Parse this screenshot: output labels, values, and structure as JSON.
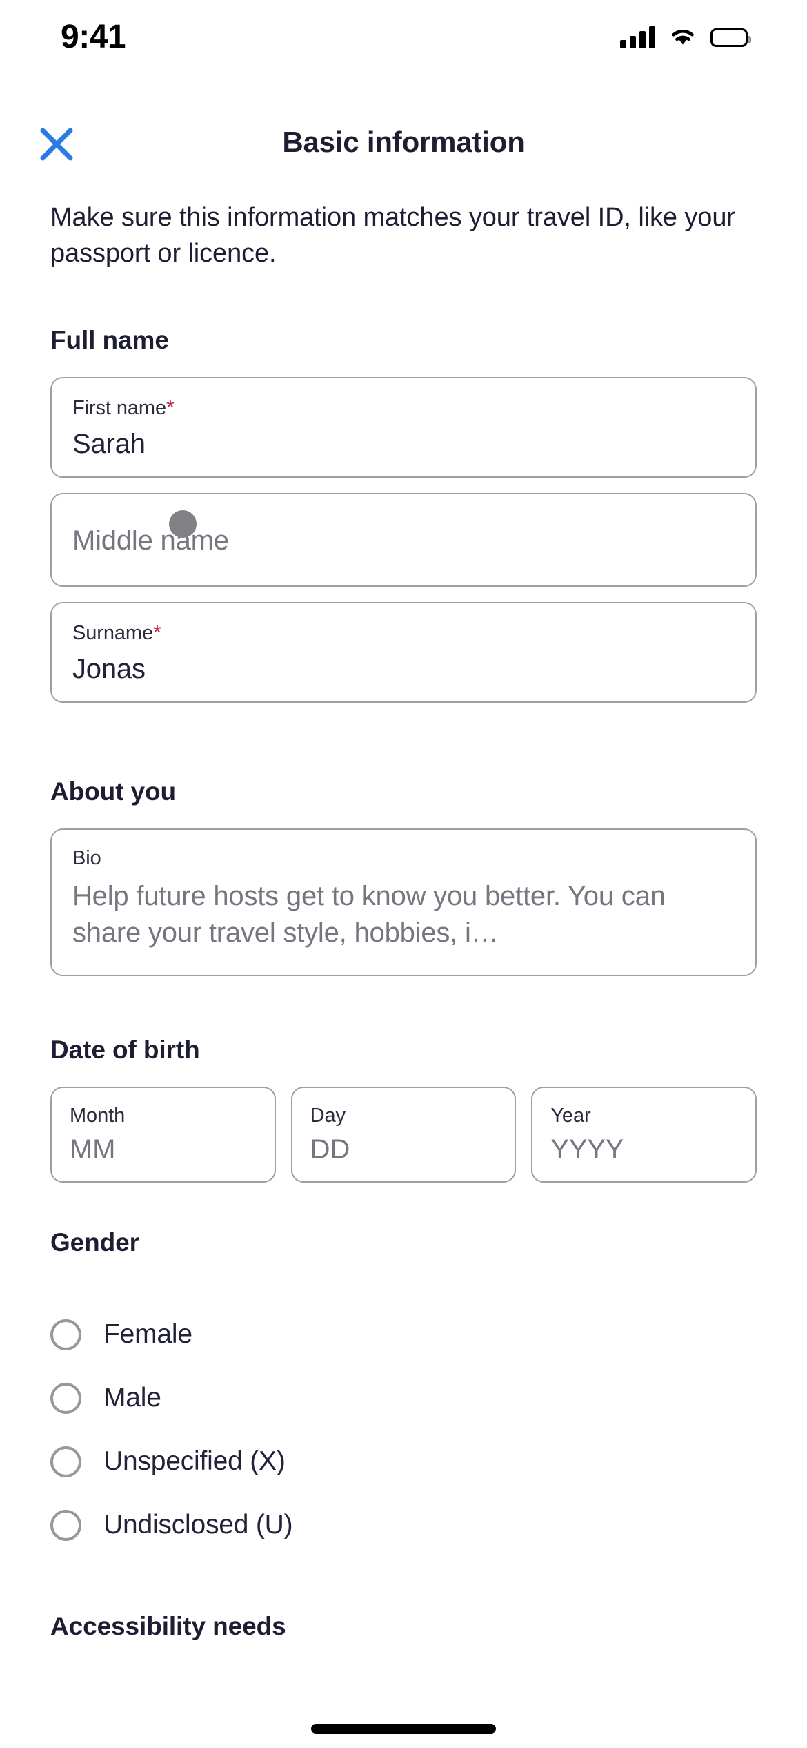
{
  "status_bar": {
    "time": "9:41",
    "signal_icon": "cellular-signal-icon",
    "wifi_icon": "wifi-icon",
    "battery_icon": "battery-icon"
  },
  "header": {
    "close_icon": "close-icon",
    "title": "Basic information"
  },
  "intro": {
    "text": "Make sure this information matches your travel ID, like your passport or licence."
  },
  "full_name": {
    "heading": "Full name",
    "first_name": {
      "label": "First name",
      "required_marker": "*",
      "value": "Sarah"
    },
    "middle_name": {
      "placeholder": "Middle name"
    },
    "surname": {
      "label": "Surname",
      "required_marker": "*",
      "value": "Jonas"
    }
  },
  "about_you": {
    "heading": "About you",
    "bio": {
      "label": "Bio",
      "placeholder": "Help future hosts get to know you better. You can share your travel style, hobbies, i…"
    }
  },
  "date_of_birth": {
    "heading": "Date of birth",
    "fields": [
      {
        "label": "Month",
        "placeholder": "MM"
      },
      {
        "label": "Day",
        "placeholder": "DD"
      },
      {
        "label": "Year",
        "placeholder": "YYYY"
      }
    ]
  },
  "gender": {
    "heading": "Gender",
    "options": [
      {
        "label": "Female",
        "selected": false
      },
      {
        "label": "Male",
        "selected": false
      },
      {
        "label": "Unspecified (X)",
        "selected": false
      },
      {
        "label": "Undisclosed (U)",
        "selected": false
      }
    ]
  },
  "accessibility": {
    "heading": "Accessibility needs"
  },
  "colors": {
    "accent_blue": "#2b7be4",
    "required_red": "#c0224b",
    "text_dark": "#1d1d33",
    "placeholder_gray": "#767680",
    "border_gray": "#9ea0a8"
  }
}
